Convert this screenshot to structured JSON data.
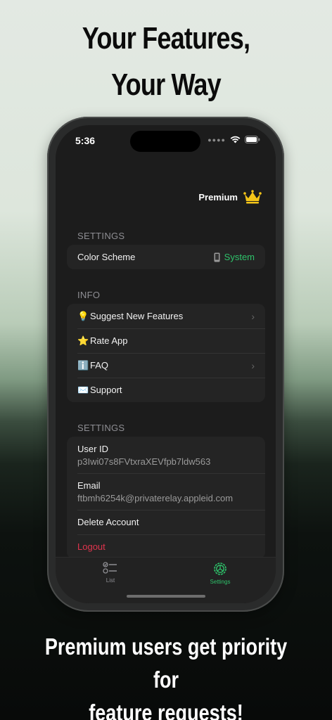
{
  "promo": {
    "headline_line1": "Your Features,",
    "headline_line2": "Your Way",
    "footer_line1": "Premium users get priority for",
    "footer_line2": "feature requests!"
  },
  "status_bar": {
    "time": "5:36"
  },
  "premium": {
    "label": "Premium",
    "icon": "crown-icon"
  },
  "settings_section": {
    "header": "SETTINGS",
    "color_scheme_label": "Color Scheme",
    "color_scheme_value": "System",
    "color_scheme_icon": "phone-icon"
  },
  "info_section": {
    "header": "INFO",
    "items": [
      {
        "emoji": "💡",
        "label": "Suggest New Features",
        "chevron": true
      },
      {
        "emoji": "⭐",
        "label": "Rate App",
        "chevron": false
      },
      {
        "emoji": "ℹ️",
        "label": "FAQ",
        "chevron": true
      },
      {
        "emoji": "✉️",
        "label": "Support",
        "chevron": false
      }
    ]
  },
  "account_section": {
    "header": "SETTINGS",
    "user_id_label": "User ID",
    "user_id_value": "p3Iwi07s8FVtxraXEVfpb7ldw563",
    "email_label": "Email",
    "email_value": "ftbmh6254k@privaterelay.appleid.com",
    "delete_label": "Delete Account",
    "logout_label": "Logout"
  },
  "tab_bar": {
    "tabs": [
      {
        "label": "List",
        "icon": "list-icon",
        "active": false
      },
      {
        "label": "Settings",
        "icon": "settings-gear-icon",
        "active": true
      }
    ]
  },
  "colors": {
    "accent": "#2ec26a",
    "destructive": "#e0344d",
    "crown": "#f5c518"
  }
}
